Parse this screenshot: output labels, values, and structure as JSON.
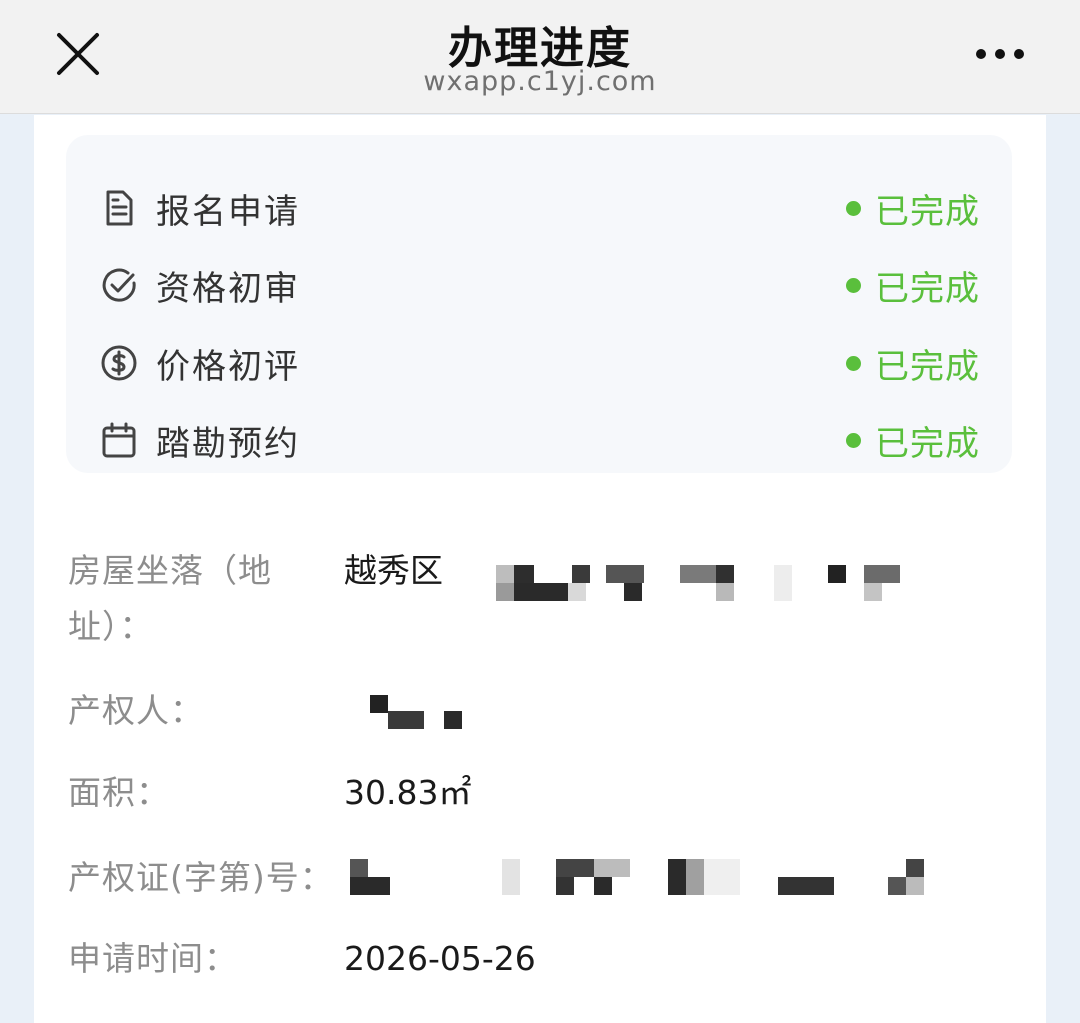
{
  "header": {
    "title": "办理进度",
    "domain": "wxapp.c1yj.com",
    "close_icon": "close-icon",
    "more_icon": "more-dots-icon"
  },
  "colors": {
    "accent_green": "#5abf3c",
    "label_gray": "#8d8d8d"
  },
  "steps": [
    {
      "icon": "document-icon",
      "label": "报名申请",
      "status": "已完成"
    },
    {
      "icon": "check-circle-icon",
      "label": "资格初审",
      "status": "已完成"
    },
    {
      "icon": "currency-icon",
      "label": "价格初评",
      "status": "已完成"
    },
    {
      "icon": "calendar-icon",
      "label": "踏勘预约",
      "status": "已完成"
    }
  ],
  "details": {
    "address": {
      "label_line1": "房屋坐落（地",
      "label_line2": "址）：",
      "value": "越秀区"
    },
    "owner": {
      "label": "产权人：",
      "value": ""
    },
    "area": {
      "label": "面积：",
      "value": "30.83㎡"
    },
    "certificate": {
      "label": "产权证(字第)号：",
      "value": ""
    },
    "apply_time": {
      "label": "申请时间：",
      "value": "2026-05-26"
    }
  }
}
